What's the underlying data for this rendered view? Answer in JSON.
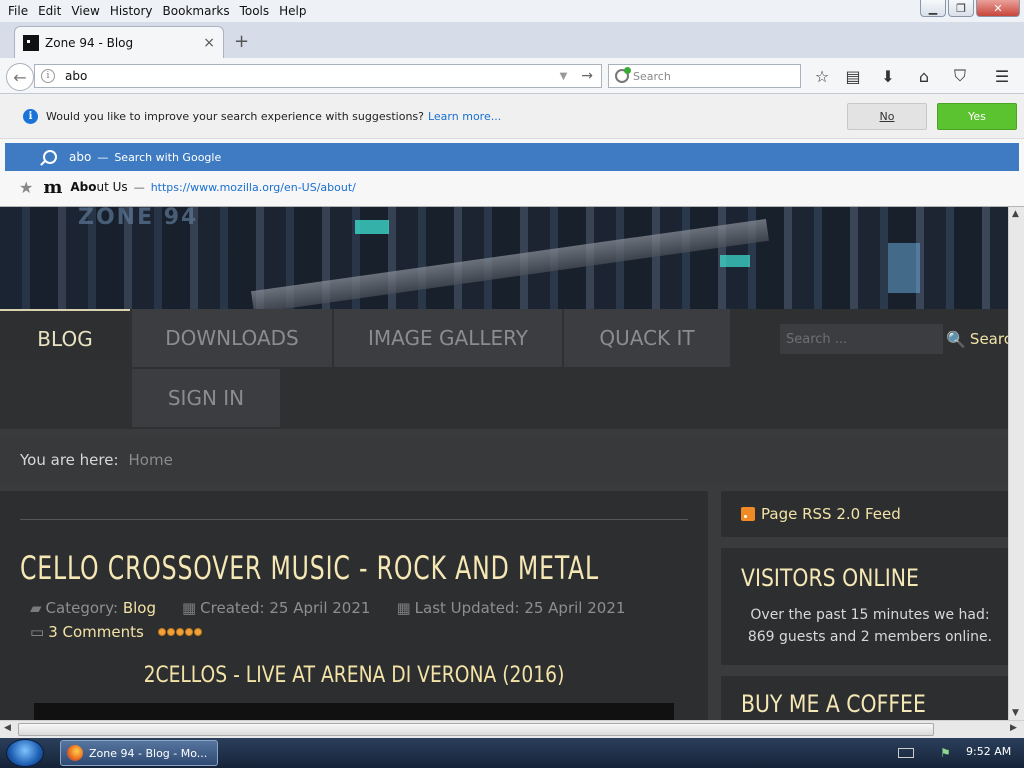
{
  "menubar": {
    "items": [
      "File",
      "Edit",
      "View",
      "History",
      "Bookmarks",
      "Tools",
      "Help"
    ]
  },
  "tab": {
    "title": "Zone 94 - Blog",
    "close": "×",
    "new_tab": "+"
  },
  "navbar": {
    "url_value": "abo",
    "search_placeholder": "Search",
    "icons": [
      "back-icon",
      "info-icon",
      "dropdown-icon",
      "go-arrow-icon",
      "bookmark-star-icon",
      "reading-list-icon",
      "downloads-icon",
      "home-icon",
      "pocket-icon",
      "hamburger-menu-icon"
    ]
  },
  "popup": {
    "banner_text": "Would you like to improve your search experience with suggestions?",
    "banner_link": "Learn more...",
    "no_label": "No",
    "yes_label": "Yes",
    "google_query": "abo",
    "google_sep": "—",
    "google_action": "Search with Google",
    "moz_title_bold": "Abo",
    "moz_title_rest": "ut Us",
    "moz_sep": "—",
    "moz_url": "https://www.mozilla.org/en-US/about/"
  },
  "page": {
    "nav": [
      "BLOG",
      "DOWNLOADS",
      "IMAGE GALLERY",
      "QUACK IT",
      "SIGN IN"
    ],
    "search_placeholder": "Search ...",
    "search_button": "Search",
    "breadcrumb_label": "You are here:",
    "breadcrumb_home": "Home",
    "article": {
      "title": "CELLO CROSSOVER MUSIC - ROCK AND METAL",
      "category_label": "Category:",
      "category_value": "Blog",
      "created": "Created: 25 April 2021",
      "updated": "Last Updated: 25 April 2021",
      "comments": "3 Comments",
      "rating_stars": 5,
      "video_title": "2CELLOS - LIVE AT ARENA DI VERONA (2016)"
    },
    "sidebar": {
      "rss": "Page RSS 2.0 Feed",
      "visitors_title": "VISITORS ONLINE",
      "visitors_line1": "Over the past 15 minutes we had:",
      "visitors_line2": "869 guests and 2 members online.",
      "coffee_title": "BUY ME A COFFEE"
    }
  },
  "taskbar": {
    "window_label": "Zone 94 - Blog - Mo...",
    "clock": "9:52 AM"
  }
}
